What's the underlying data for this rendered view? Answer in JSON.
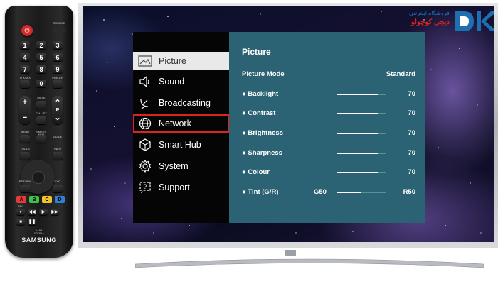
{
  "remote": {
    "brand": "SAMSUNG",
    "source_label": "SOURCE",
    "digits": [
      "1",
      "2",
      "3",
      "4",
      "5",
      "6",
      "7",
      "8",
      "9",
      "0"
    ],
    "ttx_label": "TTX/MIX",
    "prech_label": "PRE-CH",
    "mute_label": "MUTE",
    "chlist_label": "CH LIST",
    "vol_up": "+",
    "vol_down": "−",
    "ch_up": "⌃",
    "ch_down": "⌄",
    "p_label": "P",
    "menu_label": "MENU",
    "smarthub_label": "SMART HUB",
    "guide_label": "GUIDE",
    "tools_label": "TOOLS",
    "info_label": "INFO",
    "return_label": "RETURN",
    "exit_label": "EXIT",
    "color_keys": [
      "A",
      "B",
      "C",
      "D"
    ],
    "rec_label": "REC",
    "model_label": "AA59-00786A"
  },
  "menu": {
    "items": [
      {
        "label": "Picture",
        "icon": "picture-icon"
      },
      {
        "label": "Sound",
        "icon": "speaker-icon"
      },
      {
        "label": "Broadcasting",
        "icon": "satellite-dish-icon"
      },
      {
        "label": "Network",
        "icon": "globe-icon"
      },
      {
        "label": "Smart Hub",
        "icon": "cube-icon"
      },
      {
        "label": "System",
        "icon": "gear-icon"
      },
      {
        "label": "Support",
        "icon": "help-icon"
      }
    ],
    "active_index": 0,
    "highlighted_index": 3
  },
  "panel": {
    "title": "Picture",
    "picture_mode": {
      "label": "Picture Mode",
      "value": "Standard"
    },
    "settings": [
      {
        "label": "● Backlight",
        "value": "70",
        "level": 0.85
      },
      {
        "label": "● Contrast",
        "value": "70",
        "level": 0.85
      },
      {
        "label": "● Brightness",
        "value": "70",
        "level": 0.85
      },
      {
        "label": "● Sharpness",
        "value": "70",
        "level": 0.85
      },
      {
        "label": "● Colour",
        "value": "70",
        "level": 0.85
      }
    ],
    "tint": {
      "label": "● Tint (G/R)",
      "left": "G50",
      "right": "R50",
      "level": 0.5
    }
  },
  "logo": {
    "line1": "فروشگاه اینترنتی",
    "line2": "دیجی کوچولو",
    "mark": "DK",
    "colors": {
      "primary": "#1e6fb0",
      "accent": "#d9241f"
    }
  },
  "colors": {
    "panel": "#2c6374",
    "menu_bg": "#050505",
    "highlight": "#d9241f"
  }
}
